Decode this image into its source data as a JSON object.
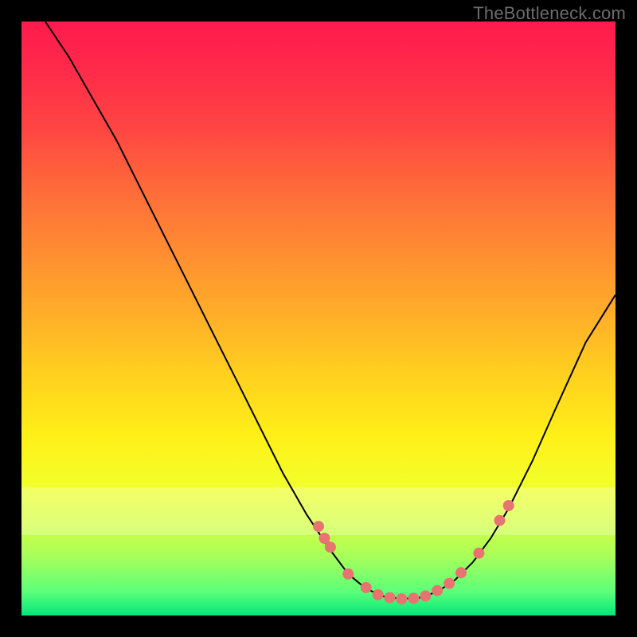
{
  "watermark": "TheBottleneck.com",
  "chart_data": {
    "type": "line",
    "title": "",
    "xlabel": "",
    "ylabel": "",
    "xlim": [
      0,
      100
    ],
    "ylim": [
      0,
      100
    ],
    "curve": [
      {
        "x": 4,
        "y": 100
      },
      {
        "x": 8,
        "y": 94
      },
      {
        "x": 12,
        "y": 87
      },
      {
        "x": 16,
        "y": 80
      },
      {
        "x": 20,
        "y": 72
      },
      {
        "x": 24,
        "y": 64
      },
      {
        "x": 28,
        "y": 56
      },
      {
        "x": 32,
        "y": 48
      },
      {
        "x": 36,
        "y": 40
      },
      {
        "x": 40,
        "y": 32
      },
      {
        "x": 44,
        "y": 24
      },
      {
        "x": 48,
        "y": 17
      },
      {
        "x": 52,
        "y": 11
      },
      {
        "x": 55,
        "y": 7
      },
      {
        "x": 58,
        "y": 4.5
      },
      {
        "x": 61,
        "y": 3.2
      },
      {
        "x": 64,
        "y": 2.8
      },
      {
        "x": 67,
        "y": 3.0
      },
      {
        "x": 70,
        "y": 4.0
      },
      {
        "x": 73,
        "y": 6.0
      },
      {
        "x": 76,
        "y": 9.0
      },
      {
        "x": 79,
        "y": 13.0
      },
      {
        "x": 82,
        "y": 18.0
      },
      {
        "x": 86,
        "y": 26.0
      },
      {
        "x": 90,
        "y": 35.0
      },
      {
        "x": 95,
        "y": 46.0
      },
      {
        "x": 100,
        "y": 54.0
      }
    ],
    "points": [
      {
        "x": 50,
        "y": 15
      },
      {
        "x": 51,
        "y": 13
      },
      {
        "x": 52,
        "y": 11.5
      },
      {
        "x": 55,
        "y": 7
      },
      {
        "x": 58,
        "y": 4.7
      },
      {
        "x": 60,
        "y": 3.5
      },
      {
        "x": 62,
        "y": 3.0
      },
      {
        "x": 64,
        "y": 2.8
      },
      {
        "x": 66,
        "y": 2.9
      },
      {
        "x": 68,
        "y": 3.3
      },
      {
        "x": 70,
        "y": 4.2
      },
      {
        "x": 72,
        "y": 5.4
      },
      {
        "x": 74,
        "y": 7.2
      },
      {
        "x": 77,
        "y": 10.5
      },
      {
        "x": 80.5,
        "y": 16
      },
      {
        "x": 82,
        "y": 18.5
      }
    ]
  }
}
